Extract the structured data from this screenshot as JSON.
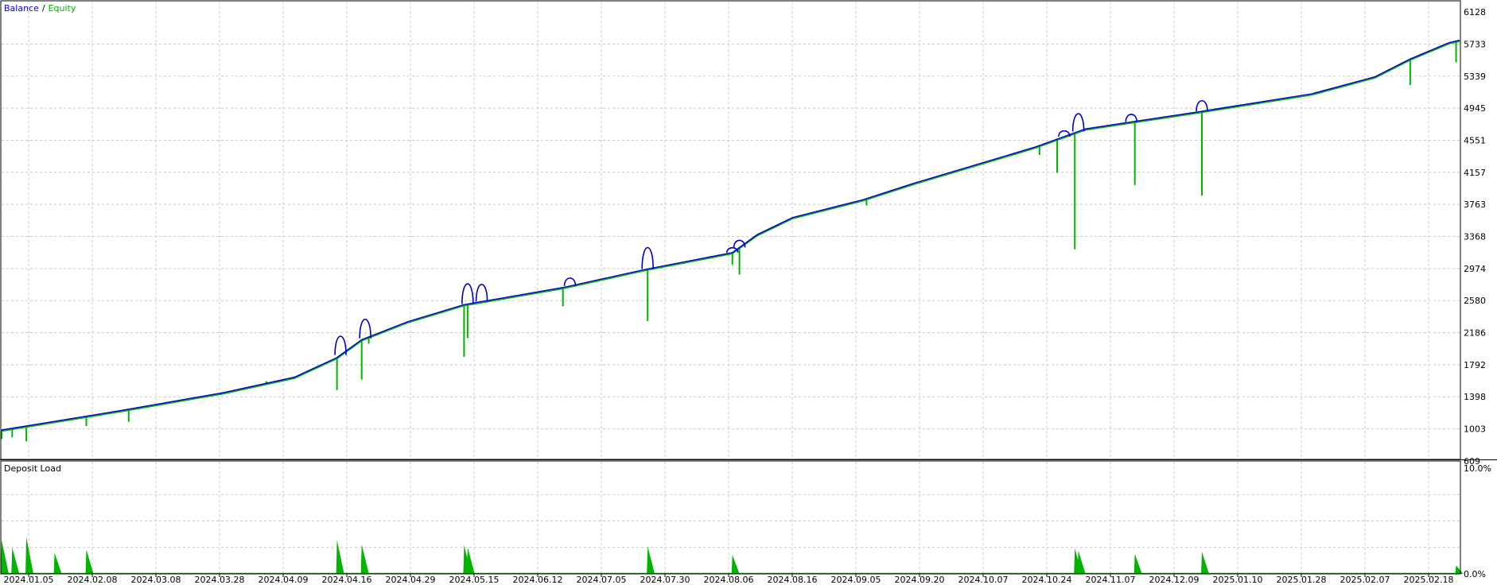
{
  "chart_data": [
    {
      "type": "line",
      "legend_placement": "top-left",
      "legend": [
        {
          "label": "Balance",
          "color": "#0000c8"
        },
        {
          "label": "/",
          "color": "#000000"
        },
        {
          "label": "Equity",
          "color": "#00b400"
        }
      ],
      "y_ticks": [
        "6128",
        "5733",
        "5339",
        "4945",
        "4551",
        "4157",
        "3763",
        "3368",
        "2974",
        "2580",
        "2186",
        "1792",
        "1398",
        "1003",
        "609"
      ],
      "ylim": [
        609,
        6128
      ],
      "grid": true,
      "x_start": "2024-01-05",
      "x_end": "2025-02-21",
      "series": [
        {
          "name": "Balance",
          "color": "#0000c8",
          "points": [
            [
              "2024-01-05",
              990
            ],
            [
              "2024-02-08",
              1230
            ],
            [
              "2024-03-08",
              1450
            ],
            [
              "2024-03-28",
              1640
            ],
            [
              "2024-04-09",
              1880
            ],
            [
              "2024-04-16",
              2100
            ],
            [
              "2024-04-29",
              2320
            ],
            [
              "2024-05-15",
              2530
            ],
            [
              "2024-06-12",
              2740
            ],
            [
              "2024-07-05",
              2960
            ],
            [
              "2024-07-30",
              3170
            ],
            [
              "2024-08-06",
              3390
            ],
            [
              "2024-08-16",
              3600
            ],
            [
              "2024-09-05",
              3820
            ],
            [
              "2024-09-20",
              4030
            ],
            [
              "2024-10-07",
              4250
            ],
            [
              "2024-10-24",
              4470
            ],
            [
              "2024-11-07",
              4690
            ],
            [
              "2024-12-09",
              4900
            ],
            [
              "2025-01-10",
              5120
            ],
            [
              "2025-01-28",
              5330
            ],
            [
              "2025-02-07",
              5550
            ],
            [
              "2025-02-18",
              5750
            ],
            [
              "2025-02-21",
              5780
            ]
          ],
          "bumps": [
            {
              "date": "2024-04-10",
              "peak": 2200
            },
            {
              "date": "2024-04-17",
              "peak": 2410
            },
            {
              "date": "2024-05-16",
              "peak": 2850
            },
            {
              "date": "2024-05-20",
              "peak": 2830
            },
            {
              "date": "2024-06-14",
              "peak": 2870
            },
            {
              "date": "2024-07-06",
              "peak": 3300
            },
            {
              "date": "2024-07-30",
              "peak": 3230
            },
            {
              "date": "2024-08-01",
              "peak": 3330
            },
            {
              "date": "2024-11-01",
              "peak": 4670
            },
            {
              "date": "2024-11-05",
              "peak": 4930
            },
            {
              "date": "2024-11-20",
              "peak": 4880
            },
            {
              "date": "2024-12-10",
              "peak": 5060
            }
          ]
        },
        {
          "name": "Equity",
          "color": "#00b400",
          "drawdowns": [
            {
              "date": "2024-01-05",
              "low": 880
            },
            {
              "date": "2024-01-08",
              "low": 900
            },
            {
              "date": "2024-01-12",
              "low": 850
            },
            {
              "date": "2024-01-29",
              "low": 1040
            },
            {
              "date": "2024-02-10",
              "low": 1090
            },
            {
              "date": "2024-03-07",
              "low": 1420
            },
            {
              "date": "2024-03-20",
              "low": 1590
            },
            {
              "date": "2024-04-09",
              "low": 1480
            },
            {
              "date": "2024-04-16",
              "low": 1610
            },
            {
              "date": "2024-04-18",
              "low": 2050
            },
            {
              "date": "2024-05-15",
              "low": 1890
            },
            {
              "date": "2024-05-16",
              "low": 2120
            },
            {
              "date": "2024-06-12",
              "low": 2510
            },
            {
              "date": "2024-07-06",
              "low": 2330
            },
            {
              "date": "2024-07-30",
              "low": 3020
            },
            {
              "date": "2024-08-01",
              "low": 2900
            },
            {
              "date": "2024-09-06",
              "low": 3750
            },
            {
              "date": "2024-10-25",
              "low": 4370
            },
            {
              "date": "2024-10-30",
              "low": 4150
            },
            {
              "date": "2024-11-04",
              "low": 3210
            },
            {
              "date": "2024-11-21",
              "low": 4000
            },
            {
              "date": "2024-12-10",
              "low": 3870
            },
            {
              "date": "2025-02-07",
              "low": 5230
            },
            {
              "date": "2025-02-20",
              "low": 5510
            }
          ]
        }
      ]
    },
    {
      "type": "area",
      "title": "Deposit Load",
      "y_ticks": [
        "10.0%",
        "0.0%"
      ],
      "ylim": [
        0,
        10
      ],
      "grid": true,
      "x_ticks": [
        "2024.01.05",
        "2024.02.08",
        "2024.03.08",
        "2024.03.28",
        "2024.04.09",
        "2024.04.16",
        "2024.04.29",
        "2024.05.15",
        "2024.06.12",
        "2024.07.05",
        "2024.07.30",
        "2024.08.06",
        "2024.08.16",
        "2024.09.05",
        "2024.09.20",
        "2024.10.07",
        "2024.10.24",
        "2024.11.07",
        "2024.12.09",
        "2025.01.10",
        "2025.01.28",
        "2025.02.07",
        "2025.02.18"
      ],
      "series": [
        {
          "name": "Deposit Load",
          "color": "#00b400",
          "spikes": [
            {
              "date": "2024-01-05",
              "pct": 3.2
            },
            {
              "date": "2024-01-08",
              "pct": 2.5
            },
            {
              "date": "2024-01-12",
              "pct": 3.5
            },
            {
              "date": "2024-01-20",
              "pct": 2.0
            },
            {
              "date": "2024-01-29",
              "pct": 2.3
            },
            {
              "date": "2024-04-09",
              "pct": 3.2
            },
            {
              "date": "2024-04-16",
              "pct": 2.8
            },
            {
              "date": "2024-05-15",
              "pct": 2.7
            },
            {
              "date": "2024-05-16",
              "pct": 2.5
            },
            {
              "date": "2024-07-06",
              "pct": 2.6
            },
            {
              "date": "2024-07-30",
              "pct": 1.8
            },
            {
              "date": "2024-11-04",
              "pct": 2.4
            },
            {
              "date": "2024-11-05",
              "pct": 2.2
            },
            {
              "date": "2024-11-21",
              "pct": 1.9
            },
            {
              "date": "2024-12-10",
              "pct": 2.1
            },
            {
              "date": "2025-02-20",
              "pct": 0.8
            }
          ]
        }
      ]
    }
  ]
}
